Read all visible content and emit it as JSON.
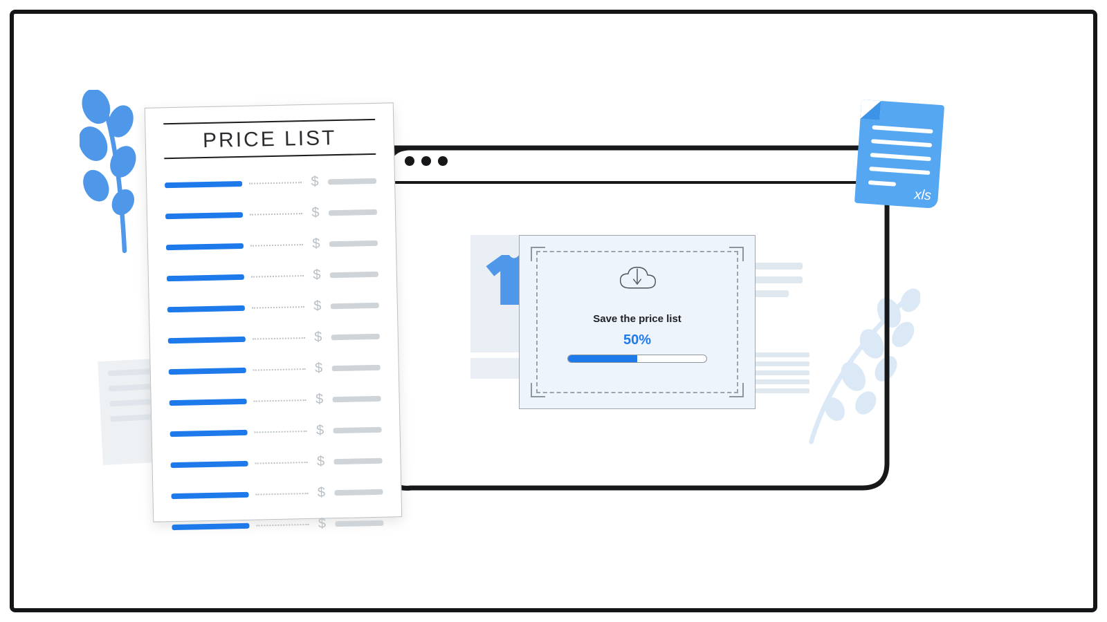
{
  "colors": {
    "accent": "#1e7aeb",
    "pale": "#e9eff4",
    "outline": "#17181a"
  },
  "plant_left": {
    "name": "leaf-branch-decoration"
  },
  "plant_right": {
    "name": "leaf-branch-decoration-pale"
  },
  "xls_card": {
    "label": "xls",
    "lines": 5
  },
  "browser": {
    "traffic_light_count": 3,
    "product_icon": "tshirt-icon"
  },
  "modal": {
    "icon": "cloud-download-icon",
    "label": "Save the price list",
    "progress_value": 50,
    "progress_label": "50%"
  },
  "price_list": {
    "title": "PRICE LIST",
    "currency_symbol": "$",
    "rows": 12
  }
}
